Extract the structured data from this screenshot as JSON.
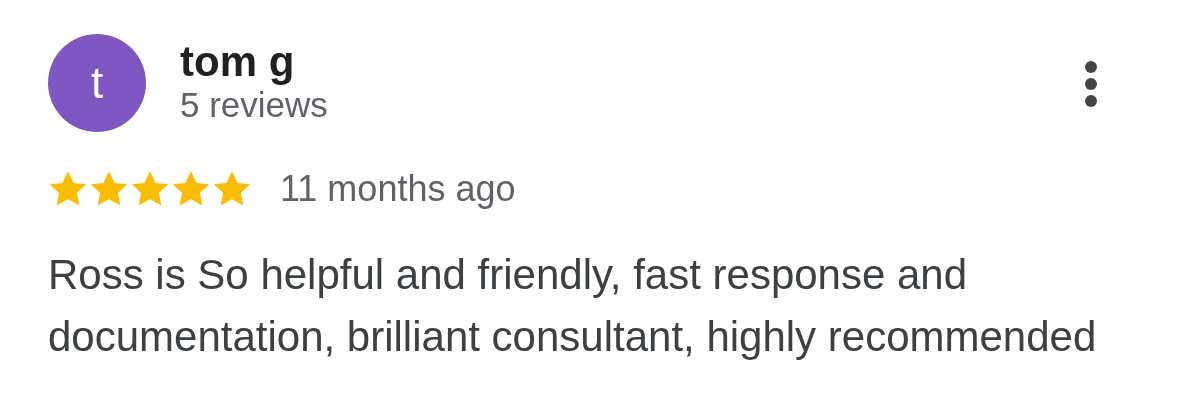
{
  "review": {
    "avatar_letter": "t",
    "author": "tom g",
    "review_count": "5 reviews",
    "stars": 5,
    "time": "11 months ago",
    "text": "Ross is So helpful and friendly, fast response and documentation, brilliant consultant, highly recommended"
  }
}
